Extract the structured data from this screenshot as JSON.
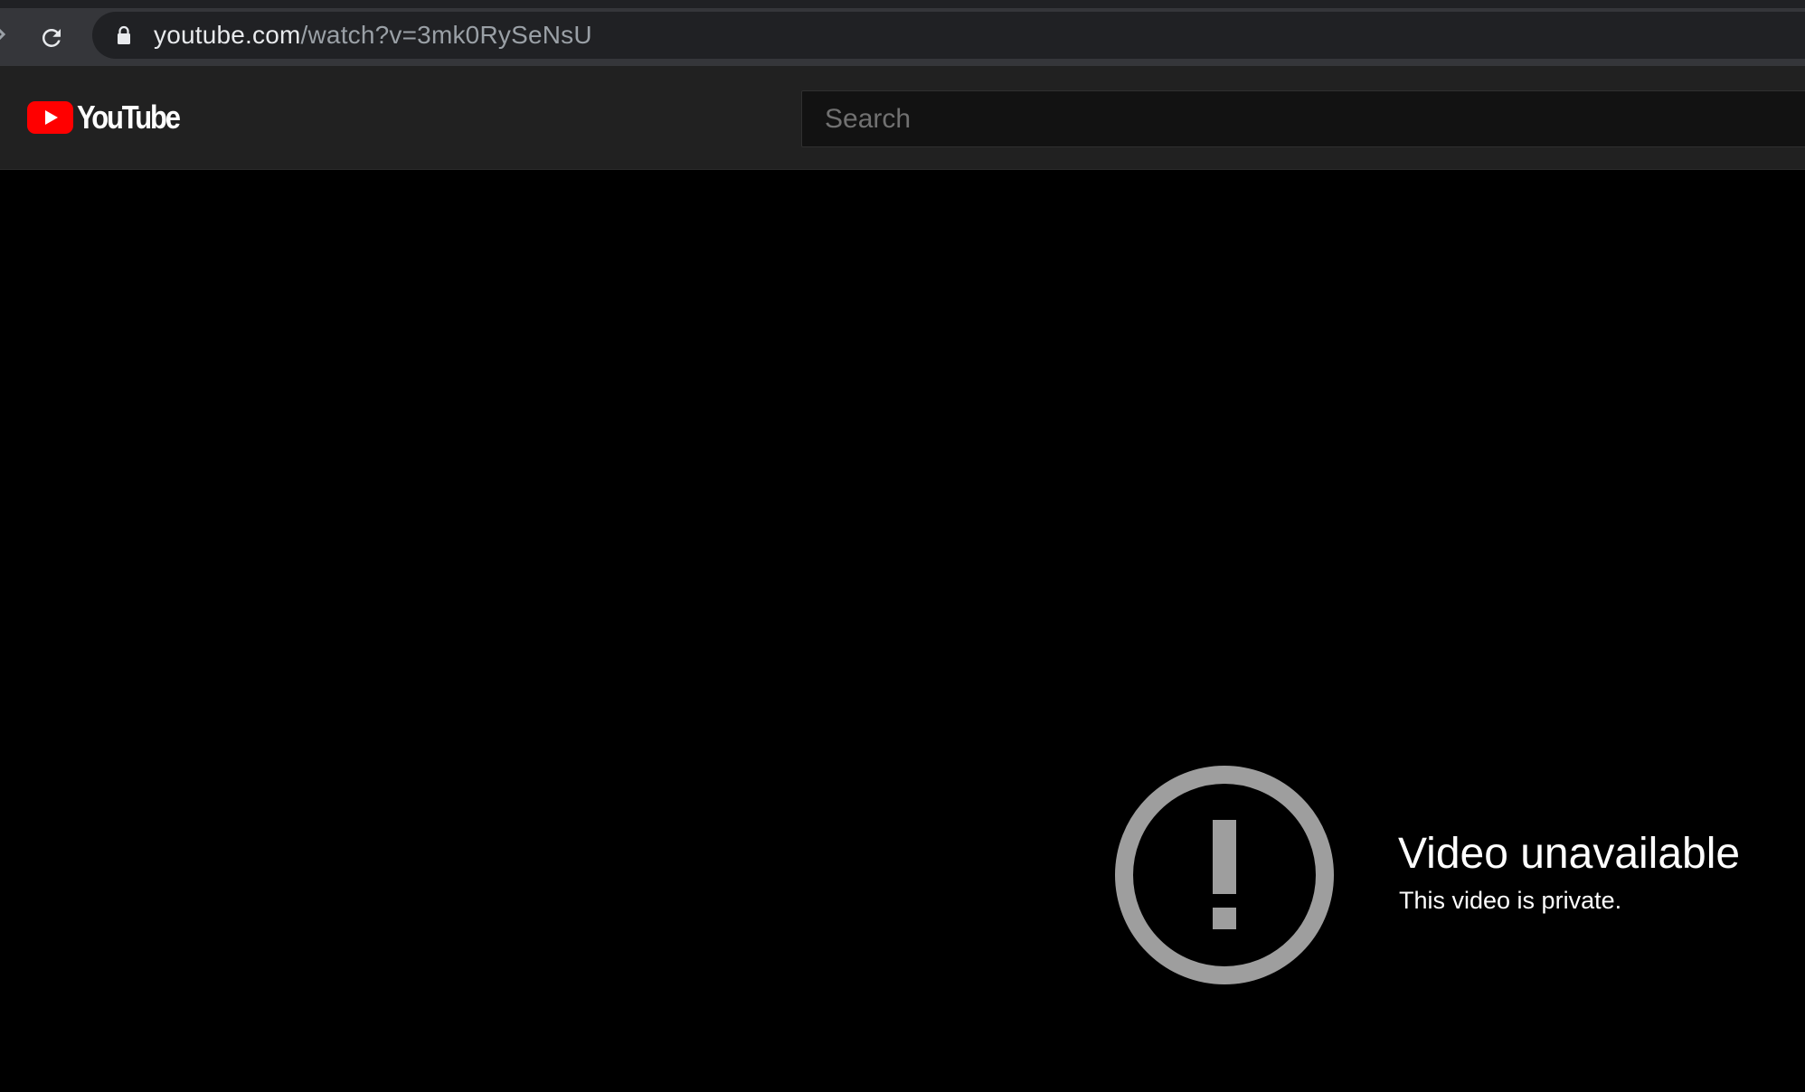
{
  "browser": {
    "url_host": "youtube.com",
    "url_path": "/watch?v=3mk0RySeNsU",
    "reload_icon": "reload-icon",
    "lock_icon": "lock-icon"
  },
  "masthead": {
    "logo_text": "YouTube",
    "logo_icon": "youtube-play-icon",
    "search_placeholder": "Search"
  },
  "player": {
    "error_icon": "exclamation-circle-icon",
    "error_title": "Video unavailable",
    "error_reason": "This video is private."
  },
  "colors": {
    "chrome_bar": "#35363a",
    "omnibox": "#202124",
    "masthead": "#212121",
    "search_bg": "#121212",
    "brand_red": "#ff0000",
    "error_icon": "#9e9e9e",
    "background": "#000000"
  }
}
